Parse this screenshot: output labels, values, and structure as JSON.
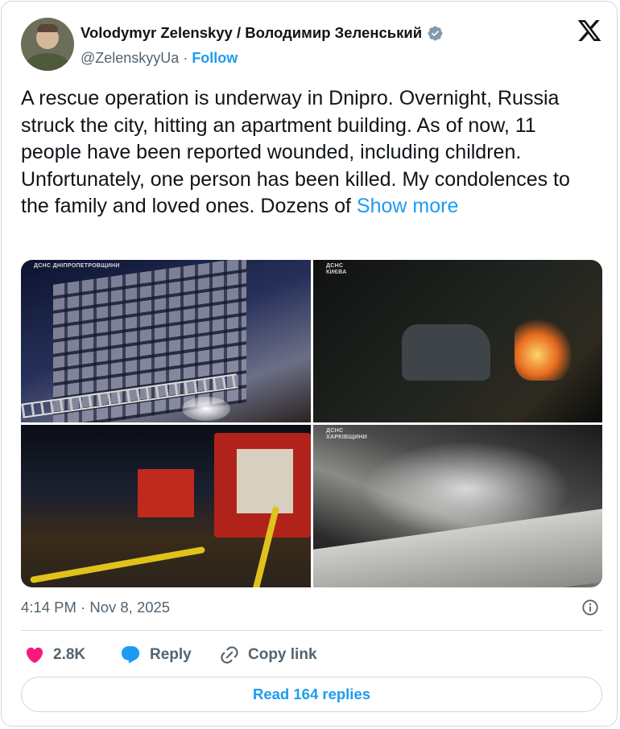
{
  "author": {
    "display_name": "Volodymyr Zelenskyy / Володимир Зеленський",
    "handle": "@ZelenskyyUa",
    "separator": " · ",
    "follow_label": "Follow",
    "verified": true
  },
  "platform_icon": "x-logo-icon",
  "tweet": {
    "text": "A rescue operation is underway in Dnipro. Overnight, Russia struck the city, hitting an apartment building. As of now, 11 people have been reported wounded, including children. Unfortunately, one person has been killed. My condolences to the family and loved ones. Dozens of ",
    "show_more_label": "Show more"
  },
  "media": {
    "photos": [
      {
        "watermark": "ДСНС ДНІПРОПЕТРОВЩИНИ"
      },
      {
        "watermark": "ДСНС\nКИЄВА"
      },
      {
        "watermark": ""
      },
      {
        "watermark": "ДСНС\nХАРКІВЩИНИ"
      }
    ]
  },
  "meta": {
    "timestamp": "4:14 PM · Nov 8, 2025",
    "info_icon": "info-icon"
  },
  "actions": {
    "like_count": "2.8K",
    "reply_label": "Reply",
    "copy_link_label": "Copy link"
  },
  "read_replies_label": "Read 164 replies",
  "colors": {
    "accent": "#1d9bf0",
    "like": "#f91880",
    "text": "#0f1419",
    "muted": "#536471",
    "border": "#cfd9de"
  }
}
